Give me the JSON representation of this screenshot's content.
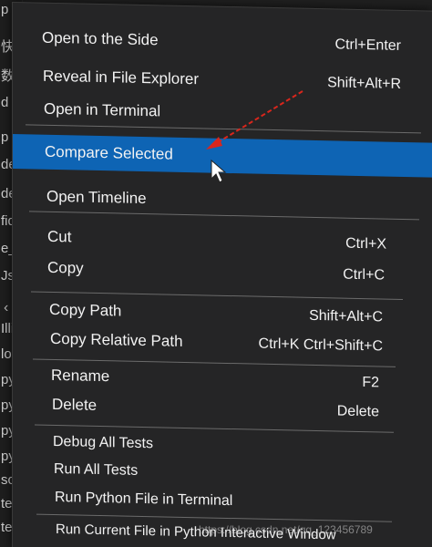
{
  "left_strip": {
    "fragments": [
      "p",
      "快",
      "数",
      "d",
      "p",
      "de",
      "de",
      "fid",
      "e_",
      "Jso",
      "Illi",
      "log",
      "py",
      "py",
      "py",
      "py",
      "sc",
      "te",
      "te"
    ]
  },
  "menu": {
    "items": [
      {
        "label": "Open to the Side",
        "shortcut": "Ctrl+Enter"
      },
      {
        "label": "Reveal in File Explorer",
        "shortcut": "Shift+Alt+R"
      },
      {
        "label": "Open in Terminal",
        "shortcut": ""
      },
      {
        "label": "Compare Selected",
        "shortcut": ""
      },
      {
        "label": "Open Timeline",
        "shortcut": ""
      },
      {
        "label": "Cut",
        "shortcut": "Ctrl+X"
      },
      {
        "label": "Copy",
        "shortcut": "Ctrl+C"
      },
      {
        "label": "Copy Path",
        "shortcut": "Shift+Alt+C"
      },
      {
        "label": "Copy Relative Path",
        "shortcut": "Ctrl+K Ctrl+Shift+C"
      },
      {
        "label": "Rename",
        "shortcut": "F2"
      },
      {
        "label": "Delete",
        "shortcut": "Delete"
      },
      {
        "label": "Debug All Tests",
        "shortcut": ""
      },
      {
        "label": "Run All Tests",
        "shortcut": ""
      },
      {
        "label": "Run Python File in Terminal",
        "shortcut": ""
      },
      {
        "label": "Run Current File in Python Interactive Window",
        "shortcut": ""
      }
    ],
    "highlight_color": "#0e64b4",
    "background_color": "#252526",
    "text_color": "#f2f2f2"
  },
  "annotation": {
    "arrow_color": "#d9261c",
    "cursor_icon": "mouse-pointer-icon"
  },
  "watermark": {
    "text": "https://blog.csdn.net/qq_123456789"
  }
}
